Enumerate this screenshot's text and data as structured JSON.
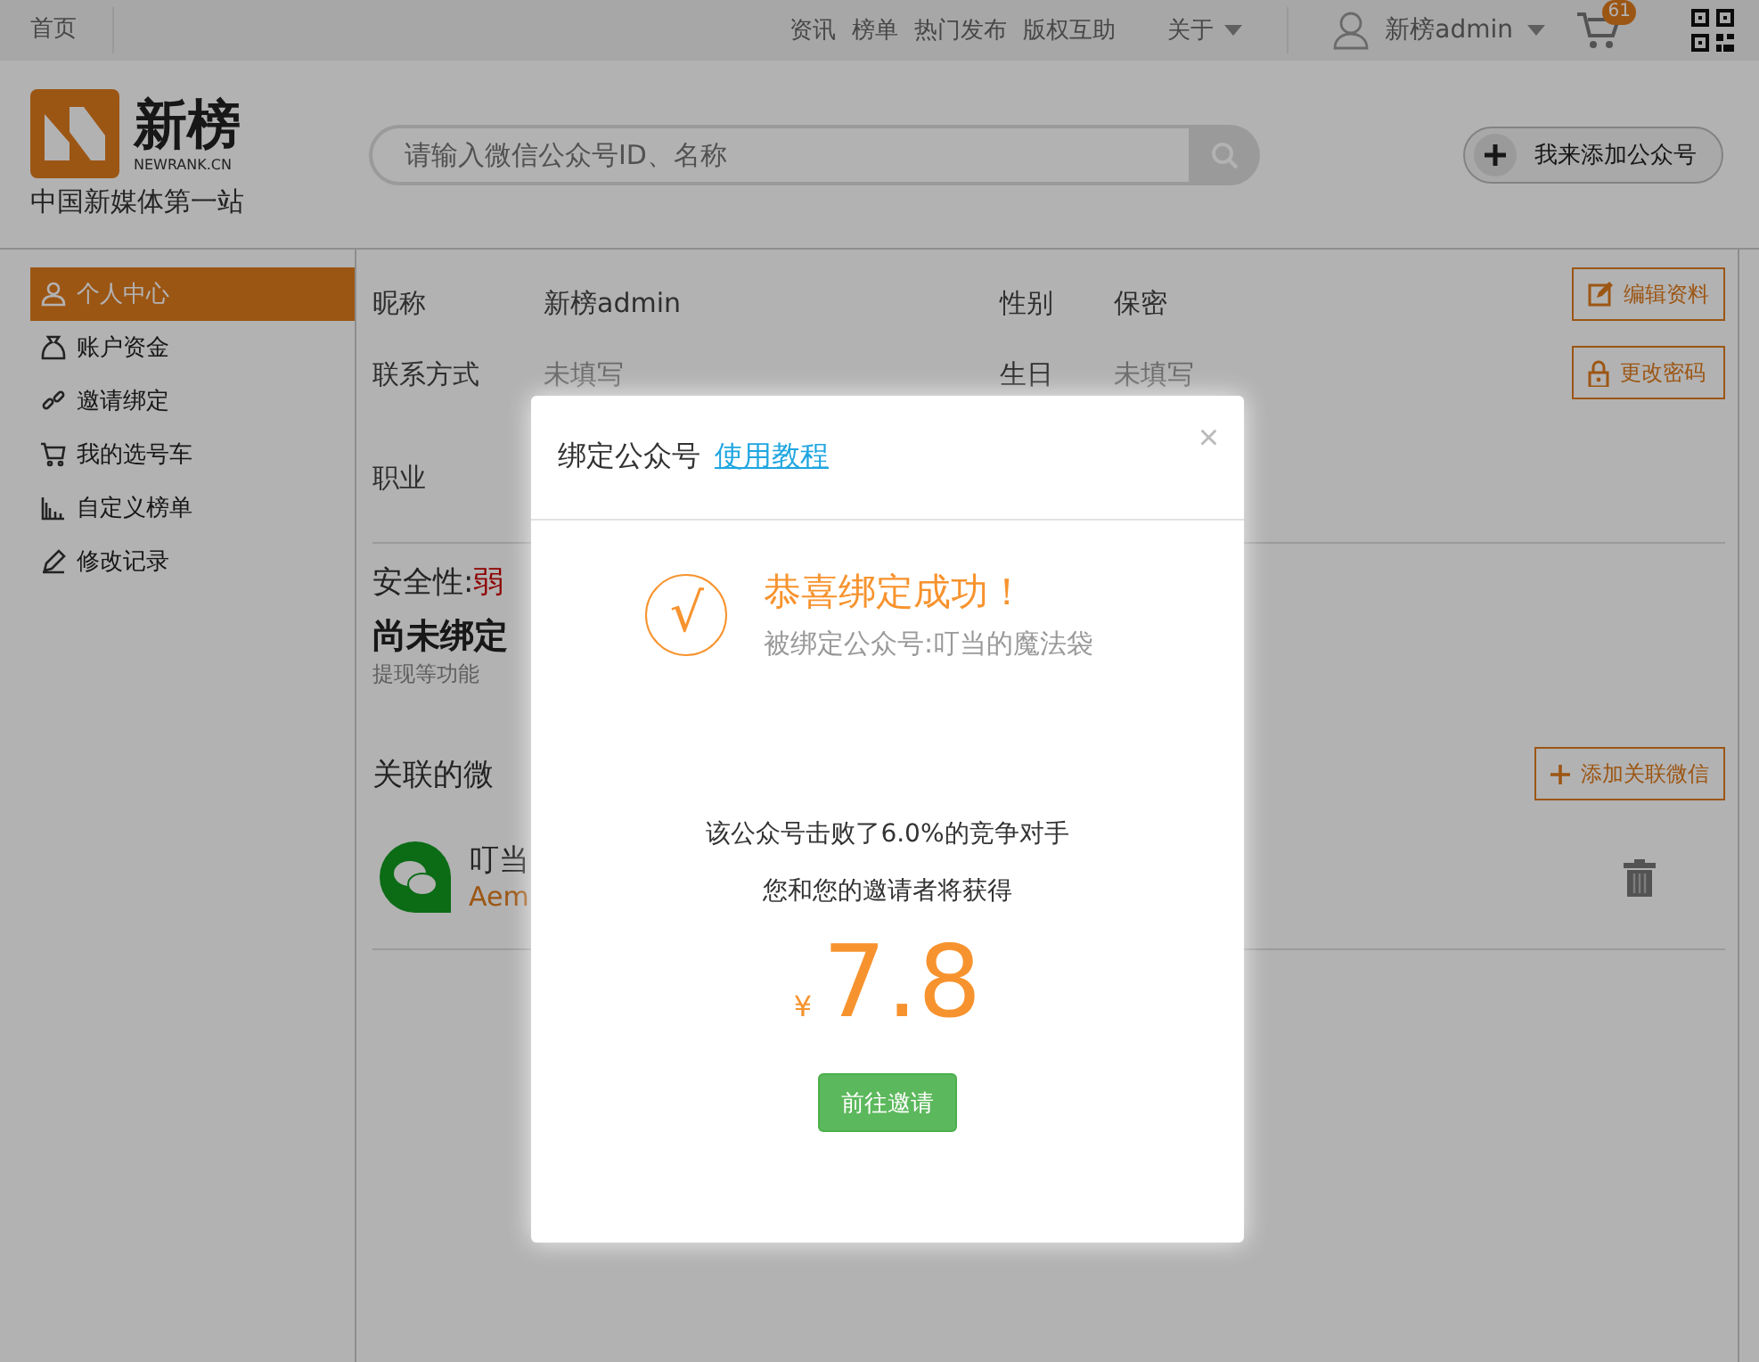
{
  "topbar": {
    "home": "首页",
    "nav": [
      "资讯",
      "榜单",
      "热门发布",
      "版权互助"
    ],
    "about": "关于",
    "user": "新榜admin",
    "cart_count": "61"
  },
  "header": {
    "logo_name": "新榜",
    "logo_sub": "NEWRANK.CN",
    "slogan": "中国新媒体第一站",
    "search": {
      "placeholder": "请输入微信公众号ID、名称"
    },
    "add_button": "我来添加公众号"
  },
  "sidebar": {
    "items": [
      {
        "label": "个人中心",
        "selected": true
      },
      {
        "label": "账户资金",
        "selected": false
      },
      {
        "label": "邀请绑定",
        "selected": false
      },
      {
        "label": "我的选号车",
        "selected": false
      },
      {
        "label": "自定义榜单",
        "selected": false
      },
      {
        "label": "修改记录",
        "selected": false
      }
    ]
  },
  "profile": {
    "rows": [
      {
        "label": "昵称",
        "value": "新榜admin",
        "filled": true,
        "label_2": "性别",
        "value_2": "保密",
        "filled_2": true
      },
      {
        "label": "联系方式",
        "value": "未填写",
        "filled": false,
        "label_2": "生日",
        "value_2": "未填写",
        "filled_2": false
      },
      {
        "label": "职业"
      }
    ],
    "buttons": [
      "编辑资料",
      "更改密码"
    ]
  },
  "security": {
    "label": "安全性:",
    "level": "弱",
    "bind_title": "尚未绑定",
    "bind_note": "提现等功能"
  },
  "linked": {
    "title": "关联的微",
    "add_button": "添加关联微信",
    "accounts": [
      {
        "name": "叮当",
        "id": "Aem"
      }
    ]
  },
  "modal": {
    "title": "绑定公众号",
    "link": "使用教程",
    "close": "×",
    "check": "√",
    "headline": "恭喜绑定成功！",
    "subline": "被绑定公众号:叮当的魔法袋",
    "stat": "该公众号击败了6.0%的竞争对手",
    "reward_note": "您和您的邀请者将获得",
    "currency": "¥",
    "amount": "7.8",
    "button": "前往邀请"
  }
}
